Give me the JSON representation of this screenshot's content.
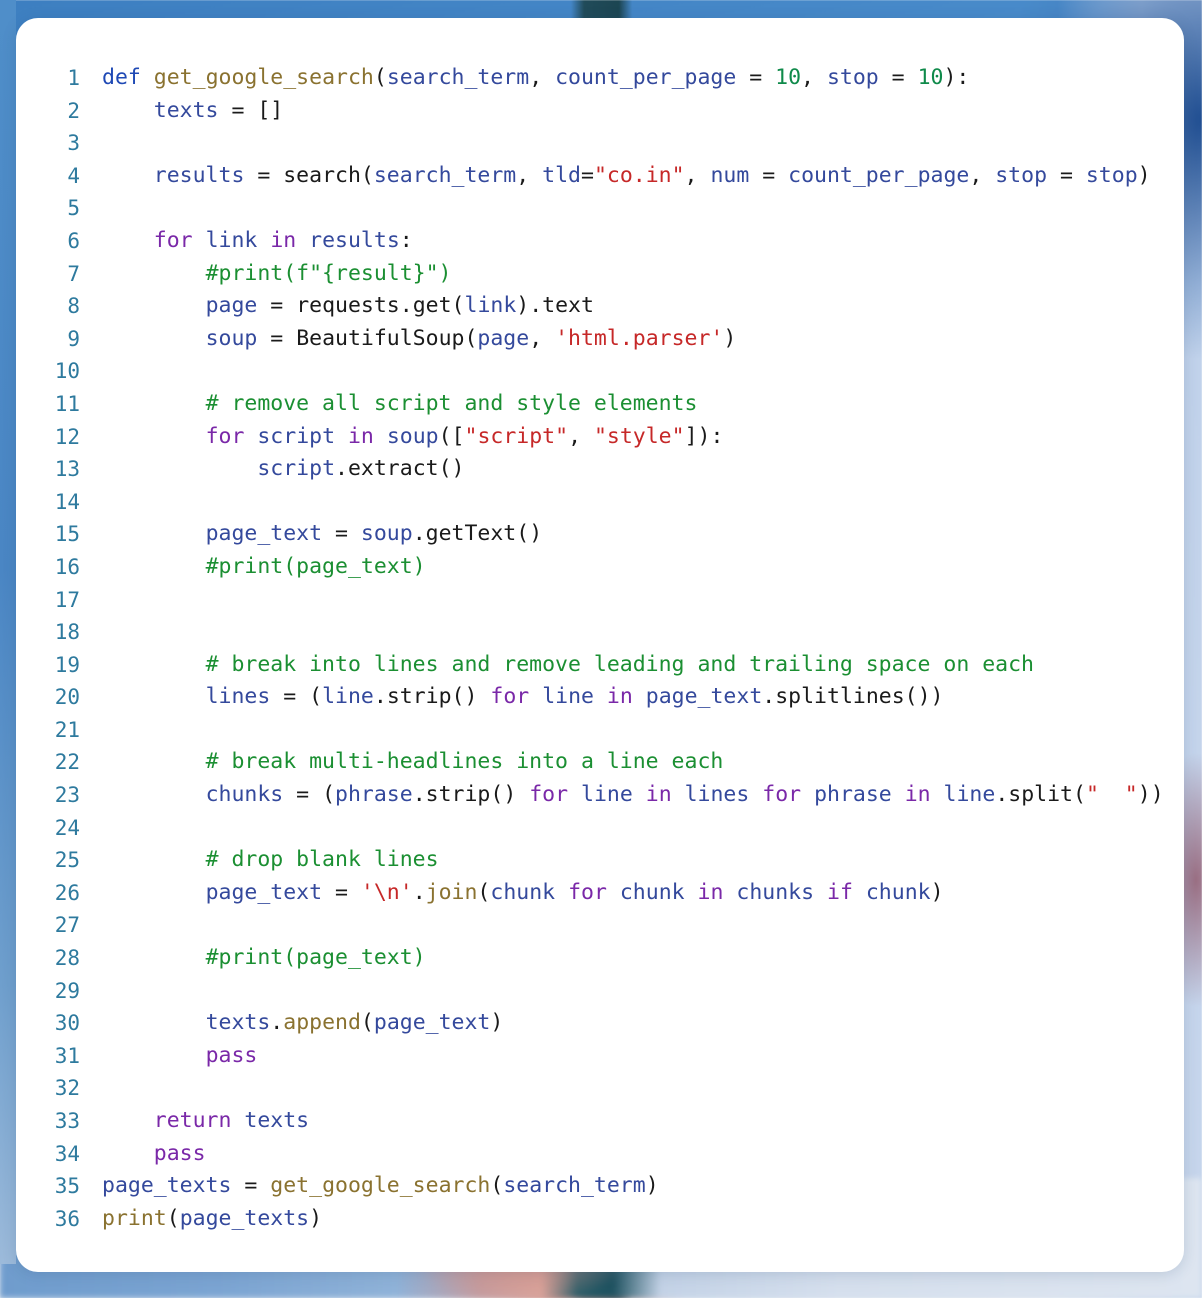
{
  "window": {
    "title": "Python code snippet",
    "language": "Python",
    "card_background": "#ffffff",
    "page_background": "#4a8ccb"
  },
  "theme": {
    "line_number_color": "#2e7a9e",
    "keyword_color": "#7a28a8",
    "def_keyword_color": "#1f49b5",
    "function_color": "#8a7230",
    "variable_color": "#34499c",
    "string_color": "#c62828",
    "number_color": "#0f8a4a",
    "comment_color": "#1b8f32",
    "default_color": "#1a1a1a"
  },
  "editor": {
    "first_line_number": 1,
    "last_line_number": 36,
    "total_lines": 36
  },
  "code": {
    "lines": [
      {
        "n": "1",
        "tokens": [
          {
            "t": "def",
            "c": "kw2"
          },
          {
            "t": " ",
            "c": "op"
          },
          {
            "t": "get_google_search",
            "c": "fn"
          },
          {
            "t": "(",
            "c": "op"
          },
          {
            "t": "search_term",
            "c": "var"
          },
          {
            "t": ", ",
            "c": "op"
          },
          {
            "t": "count_per_page",
            "c": "var"
          },
          {
            "t": " = ",
            "c": "op"
          },
          {
            "t": "10",
            "c": "num"
          },
          {
            "t": ", ",
            "c": "op"
          },
          {
            "t": "stop",
            "c": "var"
          },
          {
            "t": " = ",
            "c": "op"
          },
          {
            "t": "10",
            "c": "num"
          },
          {
            "t": "):",
            "c": "op"
          }
        ]
      },
      {
        "n": "2",
        "tokens": [
          {
            "t": "    ",
            "c": "op"
          },
          {
            "t": "texts",
            "c": "var"
          },
          {
            "t": " = []",
            "c": "op"
          }
        ]
      },
      {
        "n": "3",
        "tokens": []
      },
      {
        "n": "4",
        "tokens": [
          {
            "t": "    ",
            "c": "op"
          },
          {
            "t": "results",
            "c": "var"
          },
          {
            "t": " = ",
            "c": "op"
          },
          {
            "t": "search",
            "c": "bi"
          },
          {
            "t": "(",
            "c": "op"
          },
          {
            "t": "search_term",
            "c": "var"
          },
          {
            "t": ", ",
            "c": "op"
          },
          {
            "t": "tld",
            "c": "var"
          },
          {
            "t": "=",
            "c": "op"
          },
          {
            "t": "\"co.in\"",
            "c": "str"
          },
          {
            "t": ", ",
            "c": "op"
          },
          {
            "t": "num",
            "c": "var"
          },
          {
            "t": " = ",
            "c": "op"
          },
          {
            "t": "count_per_page",
            "c": "var"
          },
          {
            "t": ", ",
            "c": "op"
          },
          {
            "t": "stop",
            "c": "var"
          },
          {
            "t": " = ",
            "c": "op"
          },
          {
            "t": "stop",
            "c": "var"
          },
          {
            "t": ")",
            "c": "op"
          }
        ]
      },
      {
        "n": "5",
        "tokens": []
      },
      {
        "n": "6",
        "tokens": [
          {
            "t": "    ",
            "c": "op"
          },
          {
            "t": "for",
            "c": "kw"
          },
          {
            "t": " ",
            "c": "op"
          },
          {
            "t": "link",
            "c": "var"
          },
          {
            "t": " ",
            "c": "op"
          },
          {
            "t": "in",
            "c": "kw"
          },
          {
            "t": " ",
            "c": "op"
          },
          {
            "t": "results",
            "c": "var"
          },
          {
            "t": ":",
            "c": "op"
          }
        ]
      },
      {
        "n": "7",
        "tokens": [
          {
            "t": "        ",
            "c": "op"
          },
          {
            "t": "#print(f\"{result}\")",
            "c": "cmt"
          }
        ]
      },
      {
        "n": "8",
        "tokens": [
          {
            "t": "        ",
            "c": "op"
          },
          {
            "t": "page",
            "c": "var"
          },
          {
            "t": " = ",
            "c": "op"
          },
          {
            "t": "requests",
            "c": "bi"
          },
          {
            "t": ".",
            "c": "op"
          },
          {
            "t": "get",
            "c": "bi"
          },
          {
            "t": "(",
            "c": "op"
          },
          {
            "t": "link",
            "c": "var"
          },
          {
            "t": ").",
            "c": "op"
          },
          {
            "t": "text",
            "c": "bi"
          }
        ]
      },
      {
        "n": "9",
        "tokens": [
          {
            "t": "        ",
            "c": "op"
          },
          {
            "t": "soup",
            "c": "var"
          },
          {
            "t": " = ",
            "c": "op"
          },
          {
            "t": "BeautifulSoup",
            "c": "bi"
          },
          {
            "t": "(",
            "c": "op"
          },
          {
            "t": "page",
            "c": "var"
          },
          {
            "t": ", ",
            "c": "op"
          },
          {
            "t": "'html.parser'",
            "c": "str"
          },
          {
            "t": ")",
            "c": "op"
          }
        ]
      },
      {
        "n": "10",
        "tokens": []
      },
      {
        "n": "11",
        "tokens": [
          {
            "t": "        ",
            "c": "op"
          },
          {
            "t": "# remove all script and style elements",
            "c": "cmt"
          }
        ]
      },
      {
        "n": "12",
        "tokens": [
          {
            "t": "        ",
            "c": "op"
          },
          {
            "t": "for",
            "c": "kw"
          },
          {
            "t": " ",
            "c": "op"
          },
          {
            "t": "script",
            "c": "var"
          },
          {
            "t": " ",
            "c": "op"
          },
          {
            "t": "in",
            "c": "kw"
          },
          {
            "t": " ",
            "c": "op"
          },
          {
            "t": "soup",
            "c": "var"
          },
          {
            "t": "([",
            "c": "op"
          },
          {
            "t": "\"script\"",
            "c": "str"
          },
          {
            "t": ", ",
            "c": "op"
          },
          {
            "t": "\"style\"",
            "c": "str"
          },
          {
            "t": "]):",
            "c": "op"
          }
        ]
      },
      {
        "n": "13",
        "tokens": [
          {
            "t": "            ",
            "c": "op"
          },
          {
            "t": "script",
            "c": "var"
          },
          {
            "t": ".",
            "c": "op"
          },
          {
            "t": "extract",
            "c": "bi"
          },
          {
            "t": "()",
            "c": "op"
          }
        ]
      },
      {
        "n": "14",
        "tokens": []
      },
      {
        "n": "15",
        "tokens": [
          {
            "t": "        ",
            "c": "op"
          },
          {
            "t": "page_text",
            "c": "var"
          },
          {
            "t": " = ",
            "c": "op"
          },
          {
            "t": "soup",
            "c": "var"
          },
          {
            "t": ".",
            "c": "op"
          },
          {
            "t": "getText",
            "c": "bi"
          },
          {
            "t": "()",
            "c": "op"
          }
        ]
      },
      {
        "n": "16",
        "tokens": [
          {
            "t": "        ",
            "c": "op"
          },
          {
            "t": "#print(page_text)",
            "c": "cmt"
          }
        ]
      },
      {
        "n": "17",
        "tokens": []
      },
      {
        "n": "18",
        "tokens": []
      },
      {
        "n": "19",
        "tokens": [
          {
            "t": "        ",
            "c": "op"
          },
          {
            "t": "# break into lines and remove leading and trailing space on each",
            "c": "cmt"
          }
        ]
      },
      {
        "n": "20",
        "tokens": [
          {
            "t": "        ",
            "c": "op"
          },
          {
            "t": "lines",
            "c": "var"
          },
          {
            "t": " = (",
            "c": "op"
          },
          {
            "t": "line",
            "c": "var"
          },
          {
            "t": ".",
            "c": "op"
          },
          {
            "t": "strip",
            "c": "bi"
          },
          {
            "t": "() ",
            "c": "op"
          },
          {
            "t": "for",
            "c": "kw"
          },
          {
            "t": " ",
            "c": "op"
          },
          {
            "t": "line",
            "c": "var"
          },
          {
            "t": " ",
            "c": "op"
          },
          {
            "t": "in",
            "c": "kw"
          },
          {
            "t": " ",
            "c": "op"
          },
          {
            "t": "page_text",
            "c": "var"
          },
          {
            "t": ".",
            "c": "op"
          },
          {
            "t": "splitlines",
            "c": "bi"
          },
          {
            "t": "())",
            "c": "op"
          }
        ]
      },
      {
        "n": "21",
        "tokens": []
      },
      {
        "n": "22",
        "tokens": [
          {
            "t": "        ",
            "c": "op"
          },
          {
            "t": "# break multi-headlines into a line each",
            "c": "cmt"
          }
        ]
      },
      {
        "n": "23",
        "tokens": [
          {
            "t": "        ",
            "c": "op"
          },
          {
            "t": "chunks",
            "c": "var"
          },
          {
            "t": " = (",
            "c": "op"
          },
          {
            "t": "phrase",
            "c": "var"
          },
          {
            "t": ".",
            "c": "op"
          },
          {
            "t": "strip",
            "c": "bi"
          },
          {
            "t": "() ",
            "c": "op"
          },
          {
            "t": "for",
            "c": "kw"
          },
          {
            "t": " ",
            "c": "op"
          },
          {
            "t": "line",
            "c": "var"
          },
          {
            "t": " ",
            "c": "op"
          },
          {
            "t": "in",
            "c": "kw"
          },
          {
            "t": " ",
            "c": "op"
          },
          {
            "t": "lines",
            "c": "var"
          },
          {
            "t": " ",
            "c": "op"
          },
          {
            "t": "for",
            "c": "kw"
          },
          {
            "t": " ",
            "c": "op"
          },
          {
            "t": "phrase",
            "c": "var"
          },
          {
            "t": " ",
            "c": "op"
          },
          {
            "t": "in",
            "c": "kw"
          },
          {
            "t": " ",
            "c": "op"
          },
          {
            "t": "line",
            "c": "var"
          },
          {
            "t": ".",
            "c": "op"
          },
          {
            "t": "split",
            "c": "bi"
          },
          {
            "t": "(",
            "c": "op"
          },
          {
            "t": "\"  \"",
            "c": "str"
          },
          {
            "t": "))",
            "c": "op"
          }
        ]
      },
      {
        "n": "24",
        "tokens": []
      },
      {
        "n": "25",
        "tokens": [
          {
            "t": "        ",
            "c": "op"
          },
          {
            "t": "# drop blank lines",
            "c": "cmt"
          }
        ]
      },
      {
        "n": "26",
        "tokens": [
          {
            "t": "        ",
            "c": "op"
          },
          {
            "t": "page_text",
            "c": "var"
          },
          {
            "t": " = ",
            "c": "op"
          },
          {
            "t": "'\\n'",
            "c": "str"
          },
          {
            "t": ".",
            "c": "op"
          },
          {
            "t": "join",
            "c": "fn"
          },
          {
            "t": "(",
            "c": "op"
          },
          {
            "t": "chunk",
            "c": "var"
          },
          {
            "t": " ",
            "c": "op"
          },
          {
            "t": "for",
            "c": "kw"
          },
          {
            "t": " ",
            "c": "op"
          },
          {
            "t": "chunk",
            "c": "var"
          },
          {
            "t": " ",
            "c": "op"
          },
          {
            "t": "in",
            "c": "kw"
          },
          {
            "t": " ",
            "c": "op"
          },
          {
            "t": "chunks",
            "c": "var"
          },
          {
            "t": " ",
            "c": "op"
          },
          {
            "t": "if",
            "c": "kw"
          },
          {
            "t": " ",
            "c": "op"
          },
          {
            "t": "chunk",
            "c": "var"
          },
          {
            "t": ")",
            "c": "op"
          }
        ]
      },
      {
        "n": "27",
        "tokens": []
      },
      {
        "n": "28",
        "tokens": [
          {
            "t": "        ",
            "c": "op"
          },
          {
            "t": "#print(page_text)",
            "c": "cmt"
          }
        ]
      },
      {
        "n": "29",
        "tokens": []
      },
      {
        "n": "30",
        "tokens": [
          {
            "t": "        ",
            "c": "op"
          },
          {
            "t": "texts",
            "c": "var"
          },
          {
            "t": ".",
            "c": "op"
          },
          {
            "t": "append",
            "c": "fn"
          },
          {
            "t": "(",
            "c": "op"
          },
          {
            "t": "page_text",
            "c": "var"
          },
          {
            "t": ")",
            "c": "op"
          }
        ]
      },
      {
        "n": "31",
        "tokens": [
          {
            "t": "        ",
            "c": "op"
          },
          {
            "t": "pass",
            "c": "kw"
          }
        ]
      },
      {
        "n": "32",
        "tokens": []
      },
      {
        "n": "33",
        "tokens": [
          {
            "t": "    ",
            "c": "op"
          },
          {
            "t": "return",
            "c": "kw"
          },
          {
            "t": " ",
            "c": "op"
          },
          {
            "t": "texts",
            "c": "var"
          }
        ]
      },
      {
        "n": "34",
        "tokens": [
          {
            "t": "    ",
            "c": "op"
          },
          {
            "t": "pass",
            "c": "kw"
          }
        ]
      },
      {
        "n": "35",
        "tokens": [
          {
            "t": "page_texts",
            "c": "var"
          },
          {
            "t": " = ",
            "c": "op"
          },
          {
            "t": "get_google_search",
            "c": "fn"
          },
          {
            "t": "(",
            "c": "op"
          },
          {
            "t": "search_term",
            "c": "var"
          },
          {
            "t": ")",
            "c": "op"
          }
        ]
      },
      {
        "n": "36",
        "tokens": [
          {
            "t": "print",
            "c": "fn"
          },
          {
            "t": "(",
            "c": "op"
          },
          {
            "t": "page_texts",
            "c": "var"
          },
          {
            "t": ")",
            "c": "op"
          }
        ]
      }
    ],
    "plain_text": "def get_google_search(search_term, count_per_page = 10, stop = 10):\n    texts = []\n\n    results = search(search_term, tld=\"co.in\", num = count_per_page, stop = stop)\n\n    for link in results:\n        #print(f\"{result}\")\n        page = requests.get(link).text\n        soup = BeautifulSoup(page, 'html.parser')\n\n        # remove all script and style elements\n        for script in soup([\"script\", \"style\"]):\n            script.extract()\n\n        page_text = soup.getText()\n        #print(page_text)\n\n\n        # break into lines and remove leading and trailing space on each\n        lines = (line.strip() for line in page_text.splitlines())\n\n        # break multi-headlines into a line each\n        chunks = (phrase.strip() for line in lines for phrase in line.split(\"  \"))\n\n        # drop blank lines\n        page_text = '\\n'.join(chunk for chunk in chunks if chunk)\n\n        #print(page_text)\n\n        texts.append(page_text)\n        pass\n\n    return texts\n    pass\npage_texts = get_google_search(search_term)\nprint(page_texts)"
  }
}
